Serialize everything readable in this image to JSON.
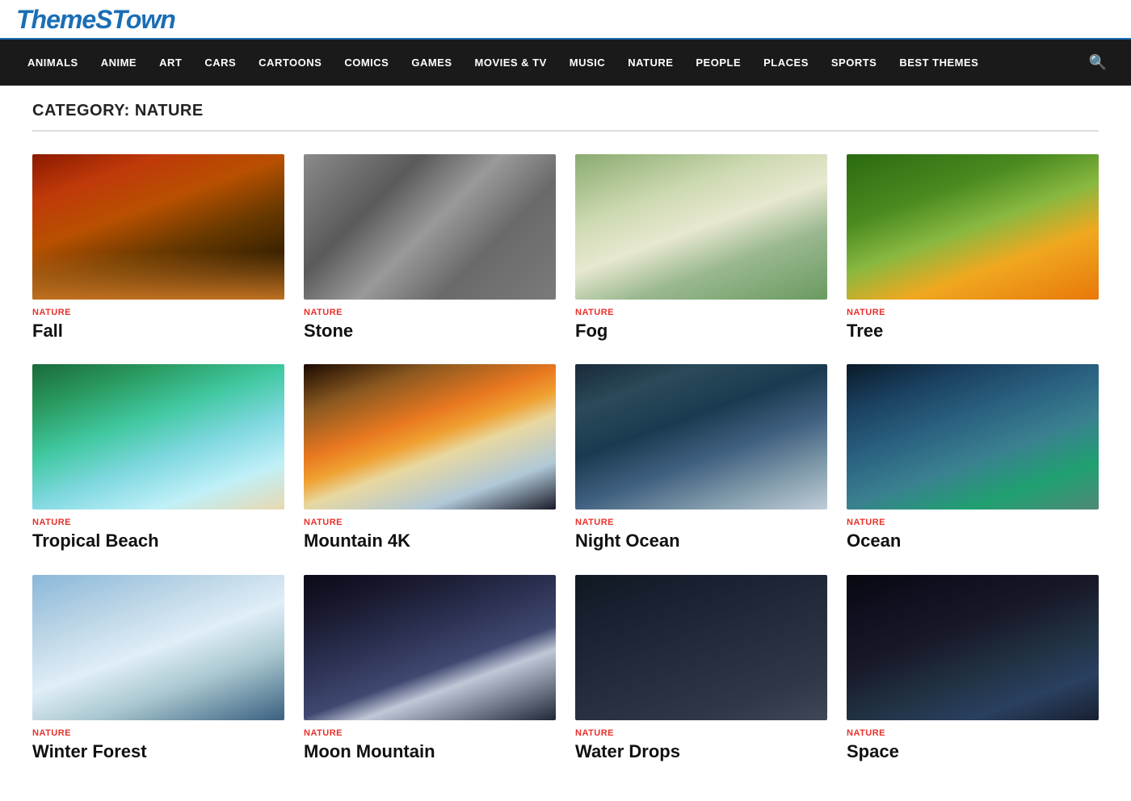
{
  "header": {
    "logo": "ThemeSTown"
  },
  "nav": {
    "items": [
      {
        "label": "ANIMALS",
        "href": "#"
      },
      {
        "label": "ANIME",
        "href": "#"
      },
      {
        "label": "ART",
        "href": "#"
      },
      {
        "label": "CARS",
        "href": "#"
      },
      {
        "label": "CARTOONS",
        "href": "#"
      },
      {
        "label": "COMICS",
        "href": "#"
      },
      {
        "label": "GAMES",
        "href": "#"
      },
      {
        "label": "MOVIES & TV",
        "href": "#"
      },
      {
        "label": "MUSIC",
        "href": "#"
      },
      {
        "label": "NATURE",
        "href": "#"
      },
      {
        "label": "PEOPLE",
        "href": "#"
      },
      {
        "label": "PLACES",
        "href": "#"
      },
      {
        "label": "SPORTS",
        "href": "#"
      },
      {
        "label": "BEST THEMES",
        "href": "#"
      }
    ]
  },
  "page": {
    "category_label": "Category: Nature"
  },
  "cards": [
    {
      "id": "fall",
      "category": "NATURE",
      "title": "Fall",
      "img_class": "img-fall"
    },
    {
      "id": "stone",
      "category": "NATURE",
      "title": "Stone",
      "img_class": "img-stone"
    },
    {
      "id": "fog",
      "category": "NATURE",
      "title": "Fog",
      "img_class": "img-fog"
    },
    {
      "id": "tree",
      "category": "NATURE",
      "title": "Tree",
      "img_class": "img-tree"
    },
    {
      "id": "tropical-beach",
      "category": "NATURE",
      "title": "Tropical Beach",
      "img_class": "img-tropical-beach"
    },
    {
      "id": "mountain-4k",
      "category": "NATURE",
      "title": "Mountain 4K",
      "img_class": "img-mountain"
    },
    {
      "id": "night-ocean",
      "category": "NATURE",
      "title": "Night Ocean",
      "img_class": "img-night-ocean"
    },
    {
      "id": "ocean",
      "category": "NATURE",
      "title": "Ocean",
      "img_class": "img-ocean"
    },
    {
      "id": "snow-trees",
      "category": "NATURE",
      "title": "Winter Forest",
      "img_class": "img-snow-trees"
    },
    {
      "id": "moon-mountain",
      "category": "NATURE",
      "title": "Moon Mountain",
      "img_class": "img-moon-mountain"
    },
    {
      "id": "water-drops",
      "category": "NATURE",
      "title": "Water Drops",
      "img_class": "img-water-drops"
    },
    {
      "id": "space",
      "category": "NATURE",
      "title": "Space",
      "img_class": "img-space"
    }
  ]
}
